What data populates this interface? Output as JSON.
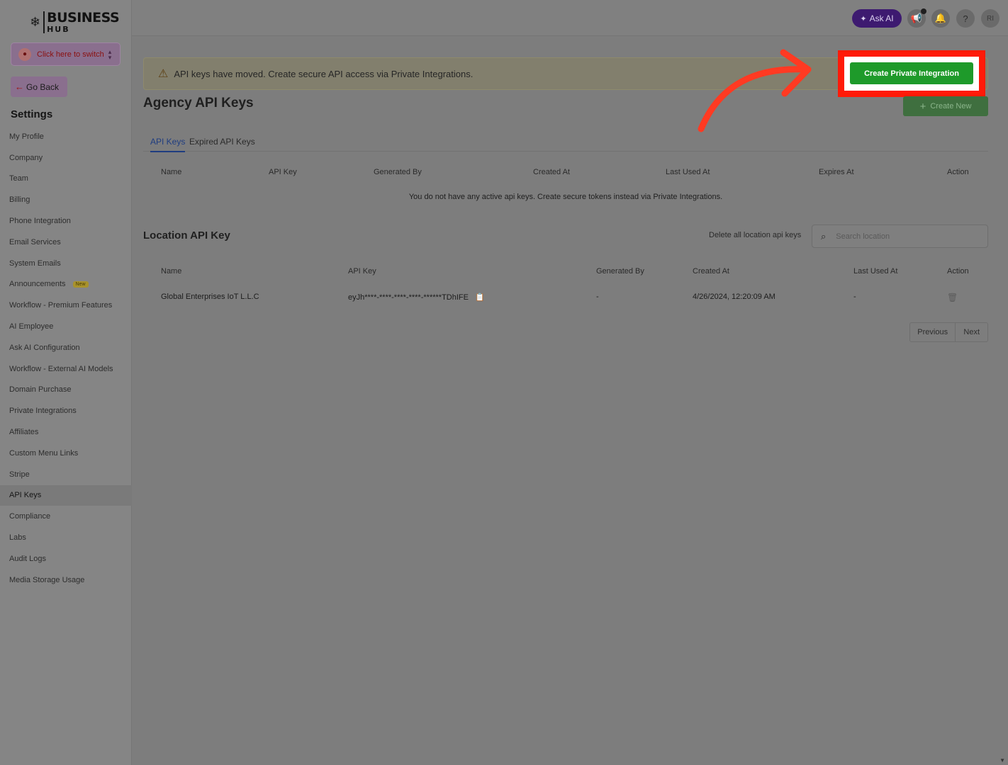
{
  "brand": {
    "main": "BUSINESS",
    "sub": "HUB"
  },
  "sidebar": {
    "switcher_label": "Click here to switch",
    "go_back": "Go Back",
    "settings_title": "Settings",
    "items": [
      {
        "label": "My Profile"
      },
      {
        "label": "Company"
      },
      {
        "label": "Team"
      },
      {
        "label": "Billing"
      },
      {
        "label": "Phone Integration"
      },
      {
        "label": "Email Services"
      },
      {
        "label": "System Emails"
      },
      {
        "label": "Announcements",
        "badge": "New"
      },
      {
        "label": "Workflow - Premium Features"
      },
      {
        "label": "AI Employee"
      },
      {
        "label": "Ask AI Configuration"
      },
      {
        "label": "Workflow - External AI Models"
      },
      {
        "label": "Domain Purchase"
      },
      {
        "label": "Private Integrations"
      },
      {
        "label": "Affiliates"
      },
      {
        "label": "Custom Menu Links"
      },
      {
        "label": "Stripe"
      },
      {
        "label": "API Keys",
        "active": true
      },
      {
        "label": "Compliance"
      },
      {
        "label": "Labs"
      },
      {
        "label": "Audit Logs"
      },
      {
        "label": "Media Storage Usage"
      }
    ]
  },
  "header": {
    "ask_ai": "Ask AI",
    "help": "?",
    "avatar": "RI"
  },
  "banner": {
    "message": "API keys have moved. Create secure API access via Private Integrations.",
    "button": "Create Private Integration"
  },
  "agency": {
    "title": "Agency API Keys",
    "create_new": "Create New",
    "tabs": [
      "API Keys",
      "Expired API Keys"
    ],
    "columns": [
      "Name",
      "API Key",
      "Generated By",
      "Created At",
      "Last Used At",
      "Expires At",
      "Action"
    ],
    "empty_message": "You do not have any active api keys. Create secure tokens instead via Private Integrations."
  },
  "location": {
    "title": "Location API Key",
    "delete_all": "Delete all location api keys",
    "search_placeholder": "Search location",
    "columns": [
      "Name",
      "API Key",
      "Generated By",
      "Created At",
      "Last Used At",
      "Action"
    ],
    "rows": [
      {
        "name": "Global Enterprises IoT L.L.C",
        "api_key": "eyJh****-****-****-****-******TDhIFE",
        "generated_by": "-",
        "created_at": "4/26/2024, 12:20:09 AM",
        "last_used_at": "-"
      }
    ],
    "pagination": {
      "previous": "Previous",
      "next": "Next"
    }
  },
  "colors": {
    "highlight_border": "#ff1a08",
    "primary_button": "#1e9a2a",
    "arrow": "#ff3a22",
    "ask_ai_bg": "#3d1a70"
  }
}
